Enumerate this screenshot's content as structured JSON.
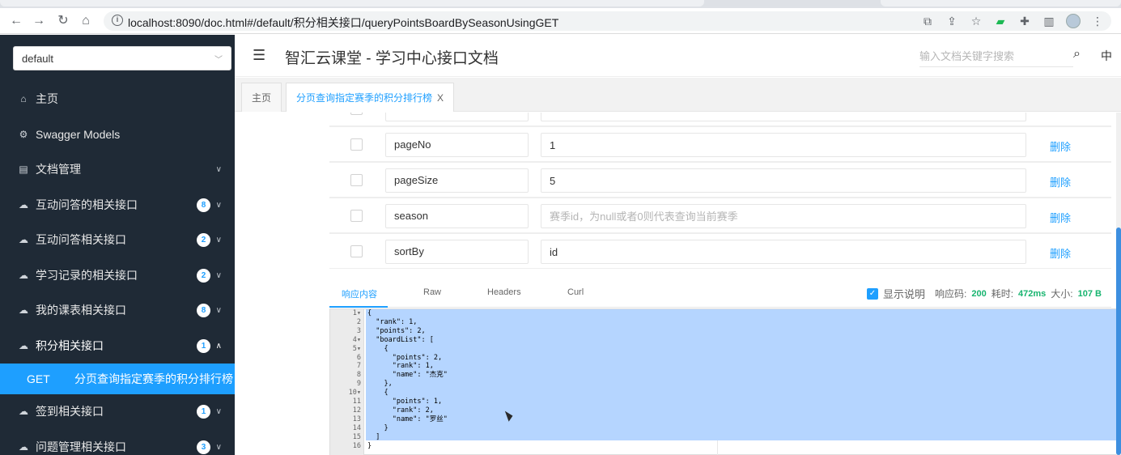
{
  "browser": {
    "url": "localhost:8090/doc.html#/default/积分相关接口/queryPointsBoardBySeasonUsingGET"
  },
  "sidebar": {
    "group_select": "default",
    "items": [
      {
        "label": "主页",
        "icon": "home-icon"
      },
      {
        "label": "Swagger Models",
        "icon": "settings-icon"
      },
      {
        "label": "文档管理",
        "icon": "doc-icon"
      },
      {
        "label": "互动问答的相关接口",
        "icon": "cloud-icon",
        "badge": "8"
      },
      {
        "label": "互动问答相关接口",
        "icon": "cloud-icon",
        "badge": "2"
      },
      {
        "label": "学习记录的相关接口",
        "icon": "cloud-icon",
        "badge": "2"
      },
      {
        "label": "我的课表相关接口",
        "icon": "cloud-icon",
        "badge": "8"
      },
      {
        "label": "积分相关接口",
        "icon": "cloud-icon",
        "badge": "1"
      }
    ],
    "active_sub": {
      "method": "GET",
      "label": "分页查询指定赛季的积分排行榜"
    },
    "items_after": [
      {
        "label": "签到相关接口",
        "icon": "cloud-icon",
        "badge": "1"
      },
      {
        "label": "问题管理相关接口",
        "icon": "cloud-icon",
        "badge": "3"
      }
    ]
  },
  "header": {
    "title": "智汇云课堂 - 学习中心接口文档",
    "search_placeholder": "输入文档关键字搜索",
    "lang": "中"
  },
  "tabs": {
    "home": "主页",
    "active": "分页查询指定赛季的积分排行榜",
    "close": "X"
  },
  "params": [
    {
      "name": "pageNo",
      "value": "1",
      "placeholder": "",
      "delete": "删除"
    },
    {
      "name": "pageSize",
      "value": "5",
      "placeholder": "",
      "delete": "删除"
    },
    {
      "name": "season",
      "value": "",
      "placeholder": "赛季id，为null或者0则代表查询当前赛季",
      "delete": "删除"
    },
    {
      "name": "sortBy",
      "value": "id",
      "placeholder": "",
      "delete": "删除"
    }
  ],
  "response": {
    "tabs": [
      "响应内容",
      "Raw",
      "Headers",
      "Curl"
    ],
    "show_desc": "显示说明",
    "code_label": "响应码:",
    "code": "200",
    "time_label": "耗时:",
    "time": "472ms",
    "size_label": "大小:",
    "size": "107 B",
    "lines": [
      "{",
      "  \"rank\": 1,",
      "  \"points\": 2,",
      "  \"boardList\": [",
      "    {",
      "      \"points\": 2,",
      "      \"rank\": 1,",
      "      \"name\": \"杰克\"",
      "    },",
      "    {",
      "      \"points\": 1,",
      "      \"rank\": 2,",
      "      \"name\": \"罗丝\"",
      "    }",
      "  ]",
      "}"
    ]
  }
}
